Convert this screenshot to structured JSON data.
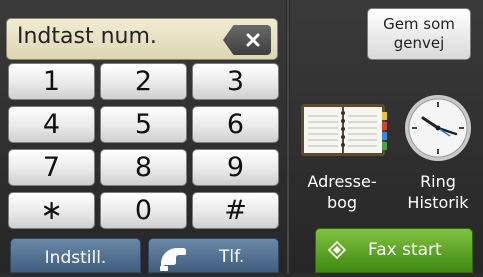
{
  "entry": {
    "text": "Indtast num."
  },
  "keypad": {
    "keys": [
      "1",
      "2",
      "3",
      "4",
      "5",
      "6",
      "7",
      "8",
      "9",
      "∗",
      "0",
      "#"
    ]
  },
  "bottom": {
    "settings_label": "Indstill.",
    "phone_label": "Tlf."
  },
  "right": {
    "shortcut_label_line1": "Gem som",
    "shortcut_label_line2": "genvej",
    "addressbook_line1": "Adresse-",
    "addressbook_line2": "bog",
    "history_line1": "Ring",
    "history_line2": "Historik",
    "fax_start_label": "Fax start"
  },
  "colors": {
    "keypad_key": "#efefef",
    "entry_bg": "#e8e2c4",
    "blue_button": "#4f6f92",
    "fax_green": "#5aa526"
  }
}
